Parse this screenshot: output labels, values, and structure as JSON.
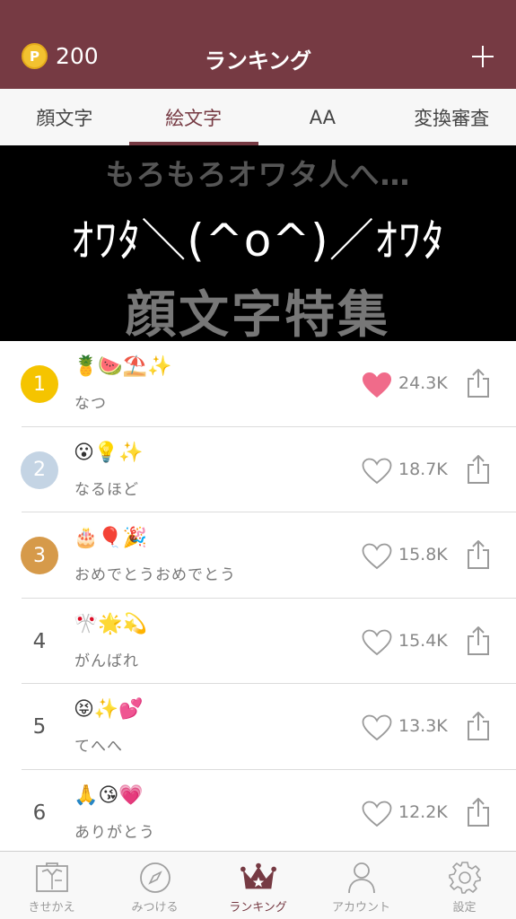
{
  "header": {
    "points": "200",
    "coin_symbol": "P",
    "title": "ランキング"
  },
  "tabs": [
    {
      "label": "顔文字",
      "active": false
    },
    {
      "label": "絵文字",
      "active": true
    },
    {
      "label": "AA",
      "active": false
    },
    {
      "label": "変換審査",
      "active": false
    }
  ],
  "banner": {
    "line1": "もろもろオワタ人へ…",
    "line2": "ｵﾜﾀ＼(^o^)／ｵﾜﾀ",
    "line3": "顔文字特集"
  },
  "ranking": [
    {
      "rank": "1",
      "emoji": "🍍🍉⛱️✨",
      "label": "なつ",
      "likes": "24.3K",
      "liked": true,
      "badge_color": "#f5c400"
    },
    {
      "rank": "2",
      "emoji": "😮💡✨",
      "label": "なるほど",
      "likes": "18.7K",
      "liked": false,
      "badge_color": "#c4d4e4"
    },
    {
      "rank": "3",
      "emoji": "🎂🎈🎉",
      "label": "おめでとうおめでとう",
      "likes": "15.8K",
      "liked": false,
      "badge_color": "#d69a4a"
    },
    {
      "rank": "4",
      "emoji": "🎌🌟💫",
      "label": "がんばれ",
      "likes": "15.4K",
      "liked": false,
      "badge_color": ""
    },
    {
      "rank": "5",
      "emoji": "😝✨💕",
      "label": "てへへ",
      "likes": "13.3K",
      "liked": false,
      "badge_color": ""
    },
    {
      "rank": "6",
      "emoji": "🙏😘💗",
      "label": "ありがとう",
      "likes": "12.2K",
      "liked": false,
      "badge_color": ""
    }
  ],
  "tabbar": [
    {
      "label": "きせかえ",
      "icon": "dress-up-icon",
      "active": false
    },
    {
      "label": "みつける",
      "icon": "compass-icon",
      "active": false
    },
    {
      "label": "ランキング",
      "icon": "crown-icon",
      "active": true
    },
    {
      "label": "アカウント",
      "icon": "person-icon",
      "active": false
    },
    {
      "label": "設定",
      "icon": "gear-icon",
      "active": false
    }
  ],
  "colors": {
    "brand": "#763a43",
    "liked_heart": "#f06b8a"
  }
}
